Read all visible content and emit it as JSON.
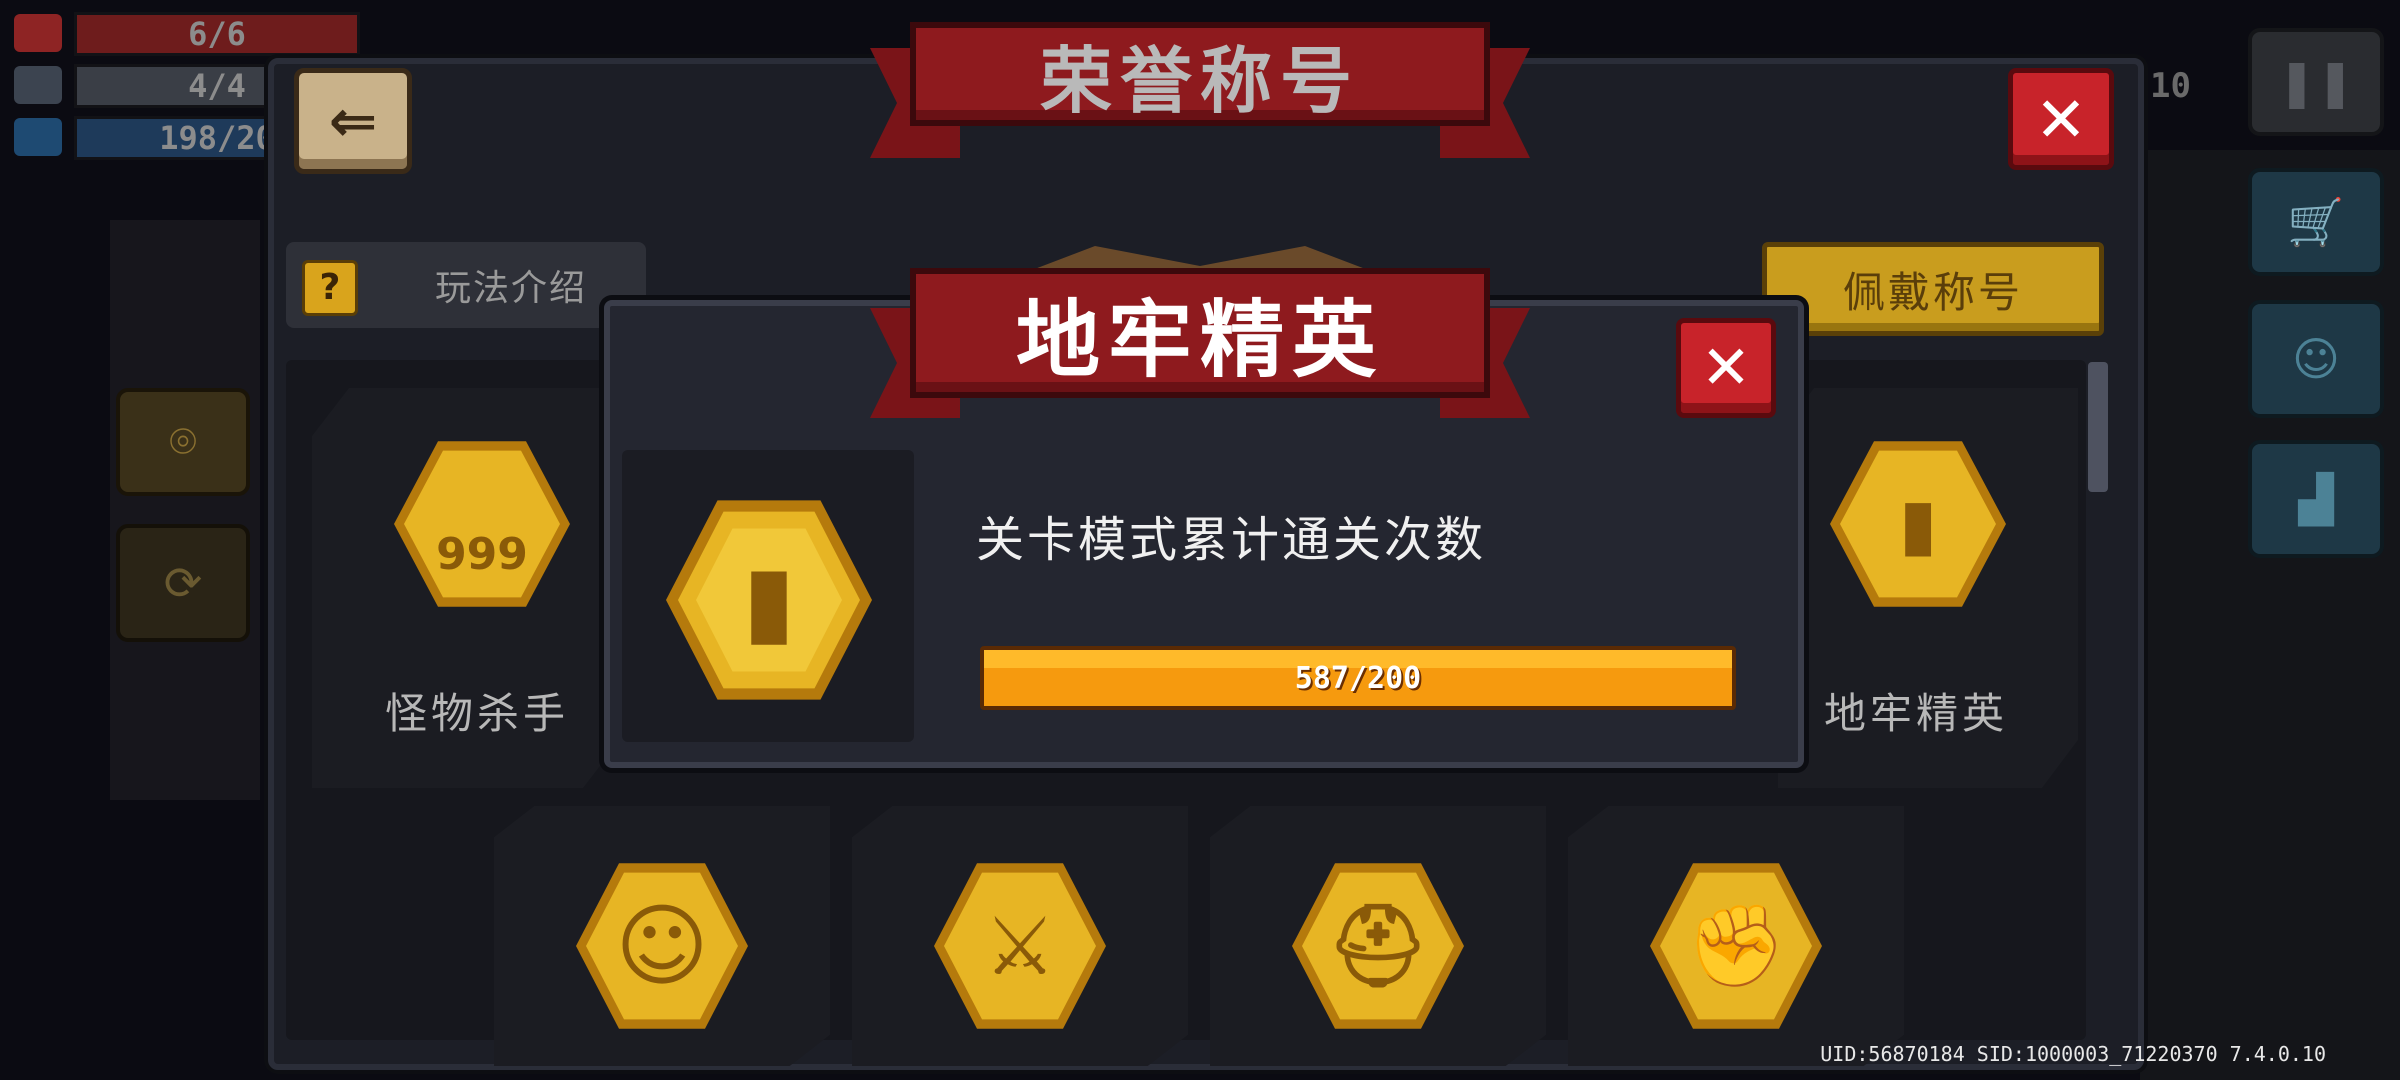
{
  "hud": {
    "hp": "6/6",
    "hp_fraction": 1.0,
    "armor": "4/4",
    "armor_fraction": 1.0,
    "energy": "198/20",
    "energy_fraction": 1.0,
    "partial_number": "10"
  },
  "panel": {
    "title": "荣誉称号",
    "help_label": "玩法介绍",
    "help_icon": "?",
    "wear_label": "佩戴称号",
    "close_icon": "✕",
    "back_icon": "⇐"
  },
  "titles": [
    {
      "label": "怪物杀手",
      "icon": "skull-999-badge-icon"
    },
    {
      "label": "地牢精英",
      "icon": "dungeon-tower-badge-icon"
    },
    {
      "label": "",
      "icon": "smile-badge-icon"
    },
    {
      "label": "",
      "icon": "crossed-swords-badge-icon"
    },
    {
      "label": "",
      "icon": "helmet-badge-icon"
    },
    {
      "label": "",
      "icon": "fist-badge-icon"
    }
  ],
  "badge_glyphs": {
    "monster": "999",
    "tower": "▮",
    "smile": "☺",
    "swords": "⚔",
    "helmet": "⛑",
    "fist": "✊"
  },
  "popup": {
    "title": "地牢精英",
    "description": "关卡模式累计通关次数",
    "progress_text": "587/200",
    "progress_fraction": 1.0,
    "close_icon": "✕"
  },
  "footer": {
    "uid_text": "UID:56870184 SID:1000003_71220370 7.4.0.10"
  }
}
